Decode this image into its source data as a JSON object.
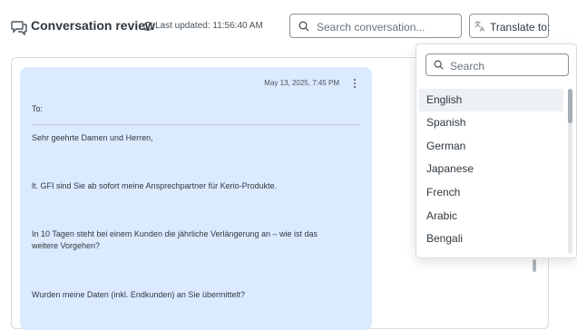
{
  "header": {
    "title": "Conversation review",
    "last_updated": "Last updated: 11:56:40 AM",
    "search_placeholder": "Search conversation...",
    "translate_label": "Translate to:"
  },
  "message": {
    "date": "May 13, 2025, 7:45 PM",
    "to_label": "To:",
    "lines": [
      "Sehr geehrte Damen und Herren,",
      "lt. GFI sind Sie ab sofort meine Ansprechpartner für Kerio-Produkte.",
      "In 10 Tagen steht bei einem Kunden die jährliche Verlängerung an – wie ist das weitere Vorgehen?",
      "Wurden meine Daten (inkl. Endkunden) an Sie übermittelt?"
    ]
  },
  "dropdown": {
    "search_placeholder": "Search",
    "options": [
      "English",
      "Spanish",
      "German",
      "Japanese",
      "French",
      "Arabic",
      "Bengali"
    ],
    "selected_index": 0
  },
  "colors": {
    "bubble": "#dbeafe",
    "border": "#87929d",
    "text": "#2f3941"
  }
}
